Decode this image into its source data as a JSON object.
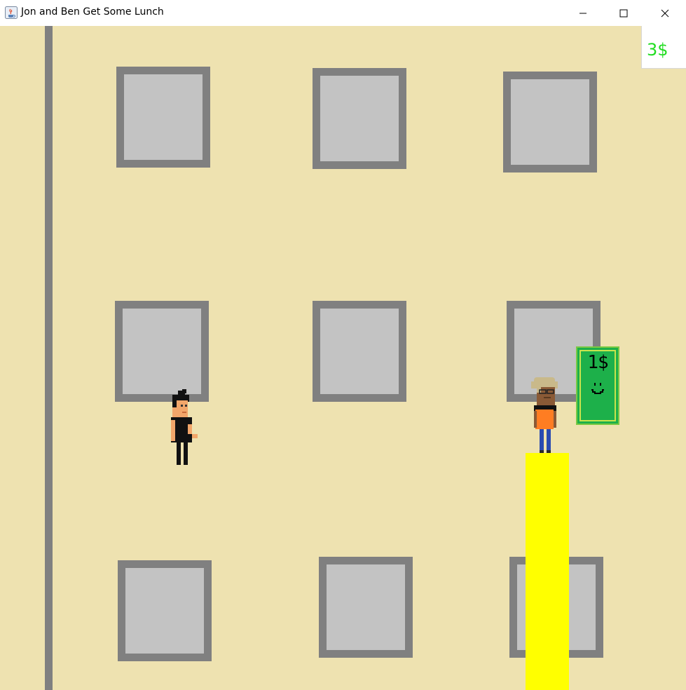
{
  "window": {
    "title": "Jon and Ben Get Some Lunch",
    "controls": [
      "minimize-icon",
      "maximize-icon",
      "close-icon"
    ]
  },
  "hud": {
    "money": "3$",
    "money_color": "#22dd22"
  },
  "pickup": {
    "label": "1$",
    "color": "#1db04a"
  },
  "scene": {
    "background_color": "#eee2b0",
    "window_frame_color": "#808080",
    "window_glass_color": "#c3c3c3",
    "platform_color": "#ffff00"
  },
  "characters": [
    {
      "role": "player",
      "description_icon": "jon-sprite-icon"
    },
    {
      "role": "npc",
      "description_icon": "ben-sprite-icon"
    }
  ]
}
